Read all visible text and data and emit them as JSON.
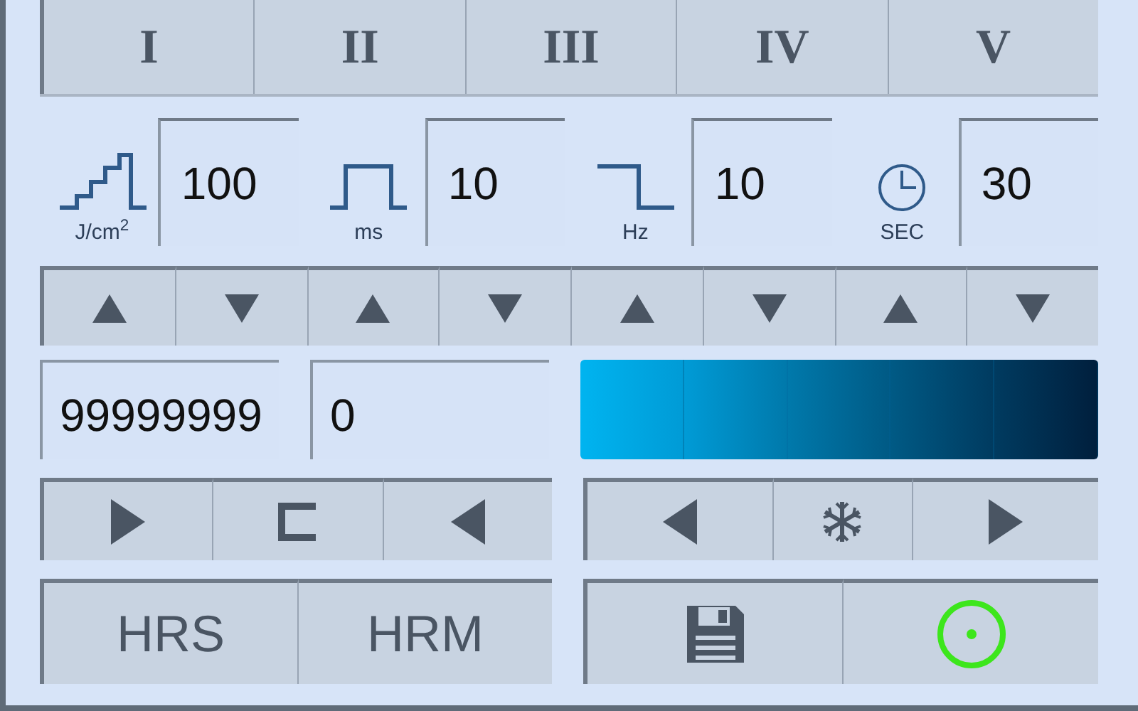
{
  "tabs": [
    {
      "label": "I"
    },
    {
      "label": "II"
    },
    {
      "label": "III"
    },
    {
      "label": "IV"
    },
    {
      "label": "V"
    }
  ],
  "parameters": [
    {
      "kind": "energy",
      "unit": "J/cm$^{2}$",
      "value": "100"
    },
    {
      "kind": "pulse",
      "unit": "ms",
      "value": "10"
    },
    {
      "kind": "frequency",
      "unit": "Hz",
      "value": "10"
    },
    {
      "kind": "time",
      "unit": "SEC",
      "value": "30"
    }
  ],
  "counters": [
    {
      "value": "99999999"
    },
    {
      "value": "0"
    }
  ],
  "mode_buttons": [
    {
      "label": "HRS"
    },
    {
      "label": "HRM"
    }
  ]
}
